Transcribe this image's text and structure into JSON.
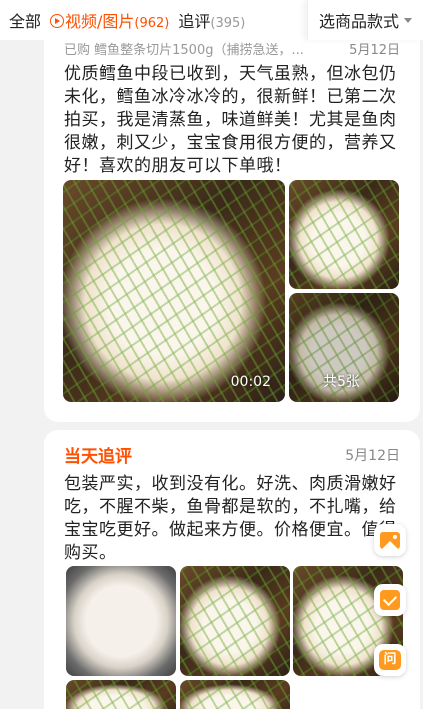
{
  "filter_bar": {
    "all_label": "全部",
    "media_label": "视频/图片",
    "media_count": "(962)",
    "followup_label": "追评",
    "followup_count": "(395)",
    "sku_label": "选商品款式"
  },
  "review1": {
    "purchased": "已购  鳕鱼整条切片1500g（捕捞急送，...",
    "date": "5月12日",
    "text": "优质鳕鱼中段已收到，天气虽熟，但冰包仍未化，鳕鱼冰冷冰冷的，很新鲜！已第二次拍买，我是清蒸鱼，味道鲜美！尤其是鱼肉很嫩，刺又少，宝宝食用很方便的，营养又好！喜欢的朋友可以下单哦！",
    "video_duration": "00:02",
    "more_photos": "共5张"
  },
  "review2": {
    "followup_tag": "当天追评",
    "date": "5月12日",
    "text": "包装严实，收到没有化。好洗、肉质滑嫩好吃，不腥不柴，鱼骨都是软的，不扎嘴，给宝宝吃更好。做起来方便。价格便宜。值得购买。"
  },
  "icons": {
    "media": "play-circle-icon",
    "sku_caret": "caret-down-icon",
    "float_1": "image-icon",
    "float_2": "checkbox-icon",
    "float_3": "ask-icon"
  },
  "float_buttons": {
    "ask_glyph": "问"
  },
  "colors": {
    "accent": "#ff5000",
    "float_icon": "#ff9a1f"
  }
}
